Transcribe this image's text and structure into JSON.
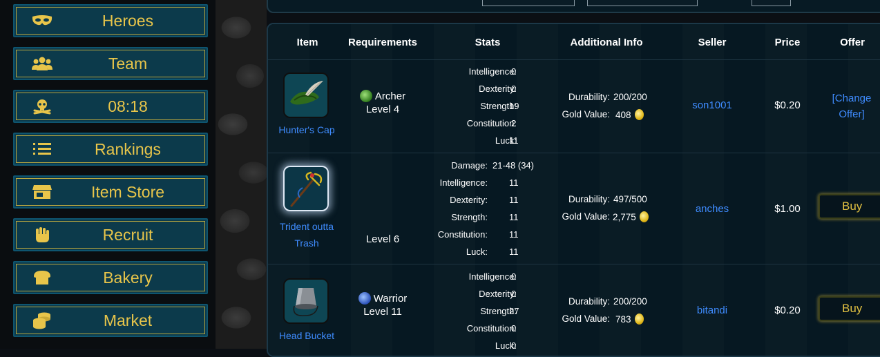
{
  "nav": [
    {
      "label": "Heroes",
      "icon": "mask-icon"
    },
    {
      "label": "Team",
      "icon": "users-icon"
    },
    {
      "label": "08:18",
      "icon": "skull-crossbones-icon"
    },
    {
      "label": "Rankings",
      "icon": "list-ol-icon"
    },
    {
      "label": "Item Store",
      "icon": "store-icon"
    },
    {
      "label": "Recruit",
      "icon": "fist-icon"
    },
    {
      "label": "Bakery",
      "icon": "bread-icon"
    },
    {
      "label": "Market",
      "icon": "coins-icon"
    }
  ],
  "table": {
    "headers": {
      "item": "Item",
      "requirements": "Requirements",
      "stats": "Stats",
      "additional_info": "Additional Info",
      "seller": "Seller",
      "price": "Price",
      "offer": "Offer"
    },
    "rows": [
      {
        "item_name": "Hunter's Cap",
        "req_class": "Archer",
        "req_level": "Level 4",
        "stats": [
          {
            "k": "Intelligence:",
            "v": "0"
          },
          {
            "k": "Dexterity:",
            "v": "0"
          },
          {
            "k": "Strength:",
            "v": "19"
          },
          {
            "k": "Constitution:",
            "v": "2"
          },
          {
            "k": "Luck:",
            "v": "11"
          }
        ],
        "durability_label": "Durability:",
        "durability": "200/200",
        "gold_label": "Gold Value:",
        "gold": "408",
        "seller": "son1001",
        "price": "$0.20",
        "offer_line1": "[Change",
        "offer_line2": "Offer]"
      },
      {
        "item_name_line1": "Trident outta",
        "item_name_line2": "Trash",
        "req_level": "Level 6",
        "stats": [
          {
            "k": "Damage:",
            "v": "21-48 (34)"
          },
          {
            "k": "Intelligence:",
            "v": "11"
          },
          {
            "k": "Dexterity:",
            "v": "11"
          },
          {
            "k": "Strength:",
            "v": "11"
          },
          {
            "k": "Constitution:",
            "v": "11"
          },
          {
            "k": "Luck:",
            "v": "11"
          }
        ],
        "durability_label": "Durability:",
        "durability": "497/500",
        "gold_label": "Gold Value:",
        "gold": "2,775",
        "seller": "anches",
        "price": "$1.00",
        "buy": "Buy"
      },
      {
        "item_name": "Head Bucket",
        "req_class": "Warrior",
        "req_level": "Level 11",
        "stats": [
          {
            "k": "Intelligence:",
            "v": "0"
          },
          {
            "k": "Dexterity:",
            "v": "0"
          },
          {
            "k": "Strength:",
            "v": "27"
          },
          {
            "k": "Constitution:",
            "v": "0"
          },
          {
            "k": "Luck:",
            "v": "0"
          }
        ],
        "durability_label": "Durability:",
        "durability": "200/200",
        "gold_label": "Gold Value:",
        "gold": "783",
        "seller": "bitandi",
        "price": "$0.20",
        "buy": "Buy"
      }
    ]
  },
  "colors": {
    "nav_bg": "#0c3a4b",
    "nav_text": "#e8c54a",
    "link": "#3f8cff",
    "panel_bg": "#071a24"
  }
}
